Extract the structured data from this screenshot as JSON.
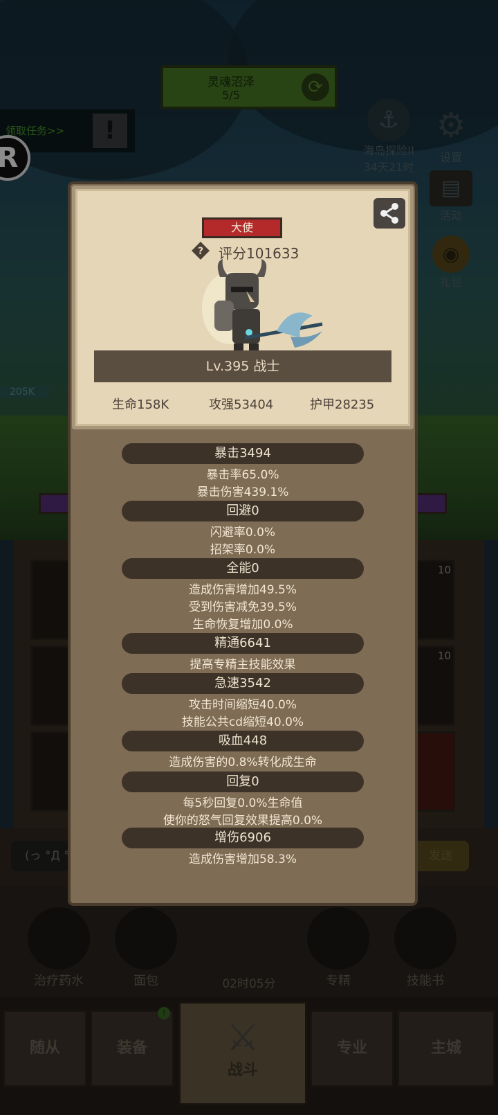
{
  "game": {
    "zone": {
      "name": "灵魂沼泽",
      "progress": "5/5"
    },
    "task_link": "领取任务>>",
    "task_badge": "!",
    "hp_tag": "205K",
    "side_menu": [
      {
        "label": "海岛探险II",
        "sub": "34天21时",
        "icon": "anchor-icon"
      },
      {
        "label": "设置",
        "icon": "gear-icon"
      },
      {
        "label": "活动",
        "icon": "scroll-icon"
      },
      {
        "label": "礼包",
        "icon": "gift-icon"
      }
    ],
    "bag_counts": [
      "10",
      "10"
    ],
    "chat": {
      "input": "(っ °Д °",
      "send": "发送"
    },
    "skills": [
      "治疗药水",
      "面包",
      "专精",
      "技能书"
    ],
    "chest_timer": "02时05分",
    "nav_tabs": [
      "随从",
      "装备",
      "战斗",
      "专业",
      "主城"
    ],
    "nav_dot": "!"
  },
  "character": {
    "rank": "大使",
    "score": "评分101633",
    "level_class": "Lv.395 战士",
    "basic": {
      "hp": "生命158K",
      "attack": "攻强53404",
      "armor": "护甲28235"
    }
  },
  "stats": [
    {
      "head": "暴击3494",
      "lines": [
        "暴击率65.0%",
        "暴击伤害439.1%"
      ]
    },
    {
      "head": "回避0",
      "lines": [
        "闪避率0.0%",
        "招架率0.0%"
      ]
    },
    {
      "head": "全能0",
      "lines": [
        "造成伤害增加49.5%",
        "受到伤害减免39.5%",
        "生命恢复增加0.0%"
      ]
    },
    {
      "head": "精通6641",
      "lines": [
        "提高专精主技能效果"
      ]
    },
    {
      "head": "急速3542",
      "lines": [
        "攻击时间缩短40.0%",
        "技能公共cd缩短40.0%"
      ]
    },
    {
      "head": "吸血448",
      "lines": [
        "造成伤害的0.8%转化成生命"
      ]
    },
    {
      "head": "回复0",
      "lines": [
        "每5秒回复0.0%生命值",
        "使你的怒气回复效果提高0.0%"
      ]
    },
    {
      "head": "增伤6906",
      "lines": [
        "造成伤害增加58.3%"
      ]
    }
  ]
}
